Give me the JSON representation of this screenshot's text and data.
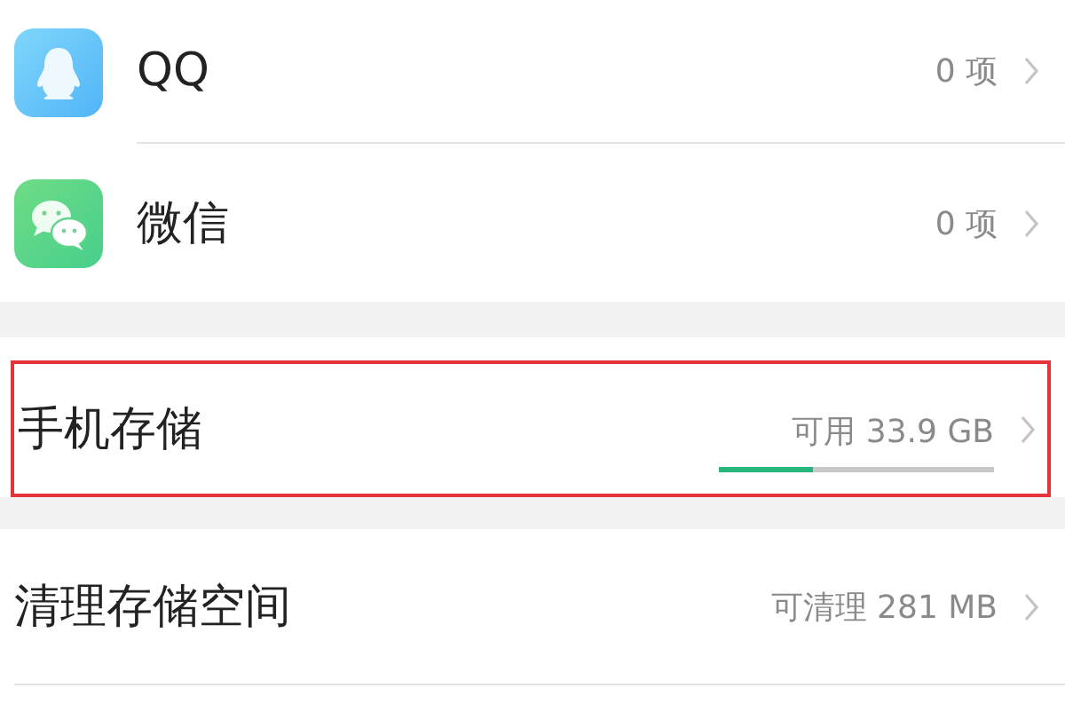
{
  "apps": [
    {
      "name": "QQ",
      "kind": "qq",
      "count": "0 项"
    },
    {
      "name": "微信",
      "kind": "wechat",
      "count": "0 项"
    }
  ],
  "storage": {
    "title": "手机存储",
    "reading": "可用 33.9 GB",
    "level": 0.34,
    "highlighted": true
  },
  "cleanup": {
    "title": "清理存储空间",
    "reading": "可清理 281 MB"
  }
}
